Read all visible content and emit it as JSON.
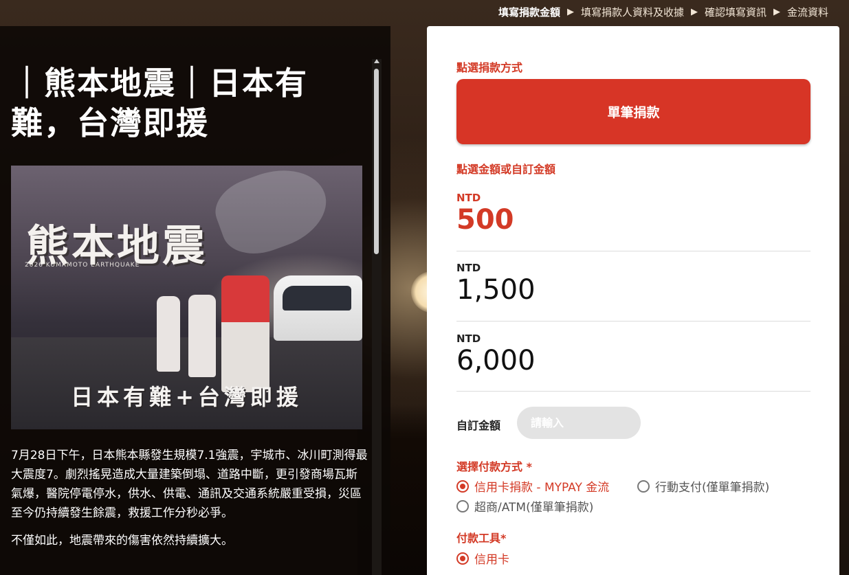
{
  "steps": [
    {
      "label": "填寫捐款金額",
      "active": true
    },
    {
      "label": "填寫捐款人資料及收據",
      "active": false
    },
    {
      "label": "確認填寫資訊",
      "active": false
    },
    {
      "label": "金流資料",
      "active": false
    }
  ],
  "step_arrow": "▶",
  "campaign": {
    "title": "｜熊本地震｜日本有難，台灣即援",
    "hero": {
      "headline": "熊本地震",
      "subtitle_en": "2026 KUMAMOTO EARTHQUAKE",
      "banner": "日本有難+台灣即援"
    },
    "paragraphs": [
      "7月28日下午，日本熊本縣發生規模7.1強震，宇城市、冰川町測得最大震度7。劇烈搖晃造成大量建築倒塌、道路中斷，更引發商場瓦斯氣爆，醫院停電停水，供水、供電、通訊及交通系統嚴重受損，災區至今仍持續發生餘震，救援工作分秒必爭。",
      "不僅如此，地震帶來的傷害依然持續擴大。"
    ]
  },
  "form": {
    "method_label": "點選捐款方式",
    "single_button": "單筆捐款",
    "amount_label": "點選金額或自訂金額",
    "amounts": [
      {
        "currency": "NTD",
        "value": "500",
        "selected": true
      },
      {
        "currency": "NTD",
        "value": "1,500",
        "selected": false
      },
      {
        "currency": "NTD",
        "value": "6,000",
        "selected": false
      }
    ],
    "custom_label": "自訂金額",
    "custom_placeholder": "請輸入",
    "payment_label": "選擇付款方式 *",
    "payment_options": [
      {
        "label": "信用卡捐款 - MYPAY 金流",
        "selected": true
      },
      {
        "label": "行動支付(僅單筆捐款)",
        "selected": false
      },
      {
        "label": "超商/ATM(僅單筆捐款)",
        "selected": false
      }
    ],
    "tool_label": "付款工具*",
    "tool_options": [
      {
        "label": "信用卡",
        "selected": true
      }
    ]
  },
  "colors": {
    "accent": "#d73526",
    "label_red": "#d33a26",
    "form_bg": "#ffffff",
    "panel_bg": "#0c0806"
  }
}
